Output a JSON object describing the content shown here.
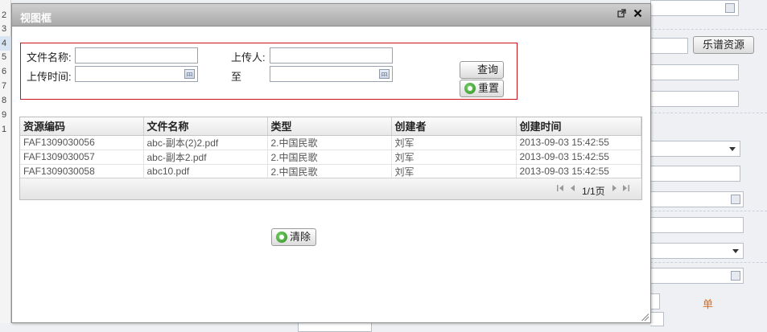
{
  "background": {
    "row_numbers": [
      "2",
      "3",
      "4",
      "5",
      "6",
      "7",
      "8",
      "9",
      "1"
    ],
    "top_clipped_label": "",
    "music_button": "乐谱资源",
    "orange_label": "单"
  },
  "dialog": {
    "title": "视图框",
    "popout_icon": "popout-icon",
    "close_icon": "close-icon"
  },
  "search": {
    "file_name_label": "文件名称:",
    "file_name_value": "",
    "uploader_label": "上传人:",
    "uploader_value": "",
    "upload_time_label": "上传时间:",
    "upload_time_from": "",
    "to_label": "至",
    "upload_time_to": "",
    "query_button": "查询",
    "reset_button": "重置"
  },
  "grid": {
    "columns": [
      "资源编码",
      "文件名称",
      "类型",
      "创建者",
      "创建时间"
    ],
    "rows": [
      [
        "FAF1309030056",
        "abc-副本(2)2.pdf",
        "2.中国民歌",
        "刘军",
        "2013-09-03 15:42:55"
      ],
      [
        "FAF1309030057",
        "abc-副本2.pdf",
        "2.中国民歌",
        "刘军",
        "2013-09-03 15:42:55"
      ],
      [
        "FAF1309030058",
        "abc10.pdf",
        "2.中国民歌",
        "刘军",
        "2013-09-03 15:42:55"
      ]
    ],
    "pager": {
      "page_text": "1/1页"
    }
  },
  "footer": {
    "clear_button": "清除"
  },
  "colors": {
    "search_border": "#c8151b",
    "title_gradient_top": "#cfcfcf",
    "title_gradient_bottom": "#a9a9a9",
    "accent_orange": "#e0691a"
  }
}
